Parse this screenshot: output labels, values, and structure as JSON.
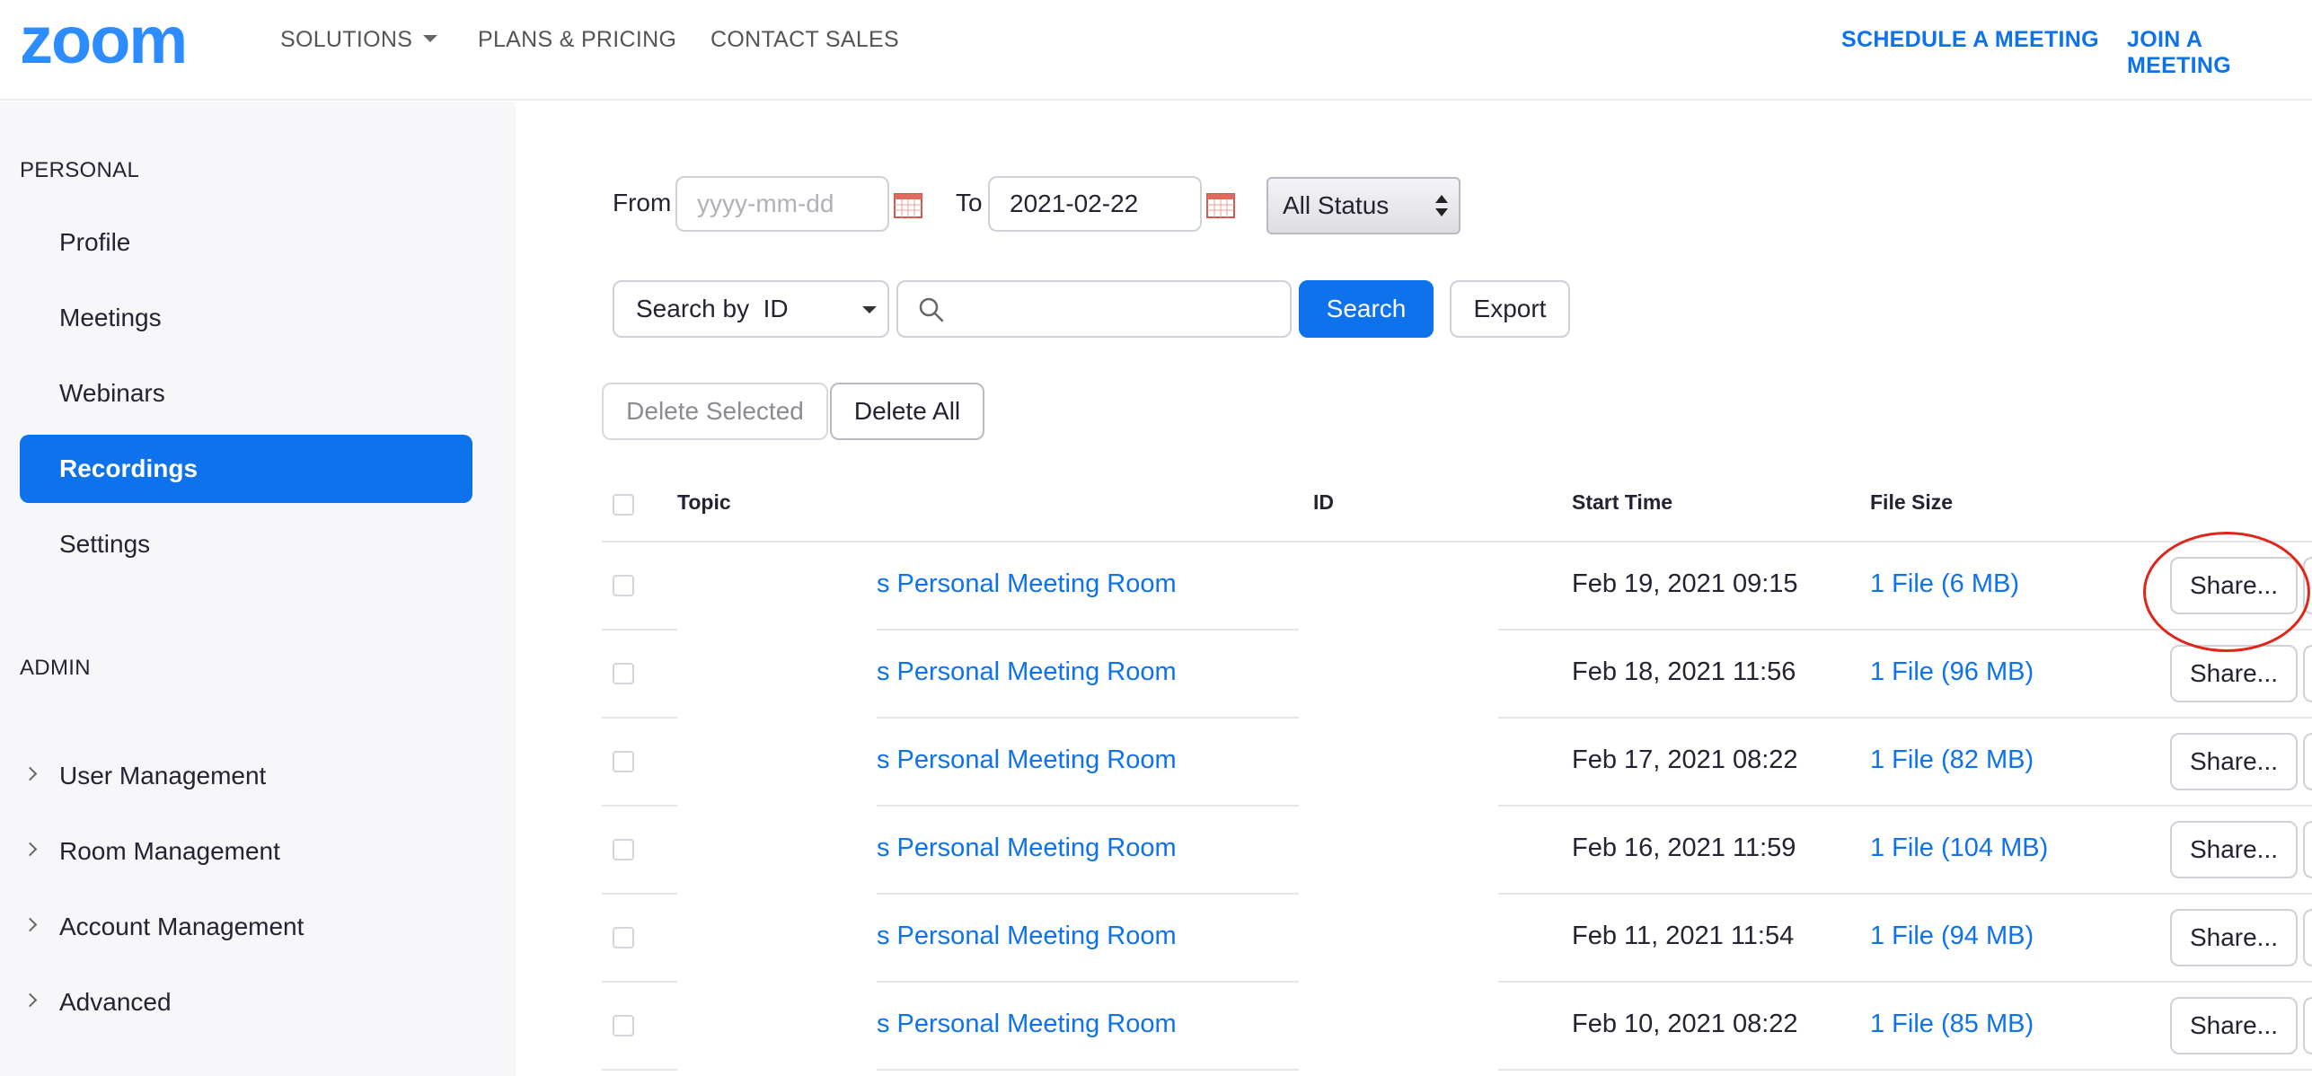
{
  "header": {
    "logo_text": "zoom",
    "nav": {
      "solutions": "SOLUTIONS",
      "plans": "PLANS & PRICING",
      "contact": "CONTACT SALES",
      "schedule": "SCHEDULE A MEETING",
      "join": "JOIN A MEETING"
    },
    "brand_color": "#0e72ed"
  },
  "sidebar": {
    "personal_heading": "PERSONAL",
    "personal_items": [
      {
        "label": "Profile"
      },
      {
        "label": "Meetings"
      },
      {
        "label": "Webinars"
      },
      {
        "label": "Recordings",
        "active": true
      },
      {
        "label": "Settings"
      }
    ],
    "admin_heading": "ADMIN",
    "admin_items": [
      {
        "label": "User Management"
      },
      {
        "label": "Room Management"
      },
      {
        "label": "Account Management"
      },
      {
        "label": "Advanced"
      }
    ]
  },
  "filters": {
    "from_label": "From",
    "from_placeholder": "yyyy-mm-dd",
    "from_value": "",
    "to_label": "To",
    "to_value": "2021-02-22",
    "status_value": "All Status",
    "search_by_value": "Search by  ID",
    "search_value": "",
    "search_button": "Search",
    "export_button": "Export",
    "delete_selected_button": "Delete Selected",
    "delete_all_button": "Delete All"
  },
  "table": {
    "columns": {
      "topic": "Topic",
      "id": "ID",
      "start_time": "Start Time",
      "file_size": "File Size"
    },
    "rows": [
      {
        "topic": "s Personal Meeting Room",
        "start_time": "Feb 19, 2021 09:15",
        "file_size": "1 File (6 MB)",
        "share": "Share..."
      },
      {
        "topic": "s Personal Meeting Room",
        "start_time": "Feb 18, 2021 11:56",
        "file_size": "1 File (96 MB)",
        "share": "Share..."
      },
      {
        "topic": "s Personal Meeting Room",
        "start_time": "Feb 17, 2021 08:22",
        "file_size": "1 File (82 MB)",
        "share": "Share..."
      },
      {
        "topic": "s Personal Meeting Room",
        "start_time": "Feb 16, 2021 11:59",
        "file_size": "1 File (104 MB)",
        "share": "Share..."
      },
      {
        "topic": "s Personal Meeting Room",
        "start_time": "Feb 11, 2021 11:54",
        "file_size": "1 File (94 MB)",
        "share": "Share..."
      },
      {
        "topic": "s Personal Meeting Room",
        "start_time": "Feb 10, 2021 08:22",
        "file_size": "1 File (85 MB)",
        "share": "Share..."
      }
    ]
  },
  "icons": {
    "calendar": "calendar-icon",
    "search": "search-icon",
    "chevron": "chevron-right-icon"
  },
  "annotation_color": "#e0261b"
}
